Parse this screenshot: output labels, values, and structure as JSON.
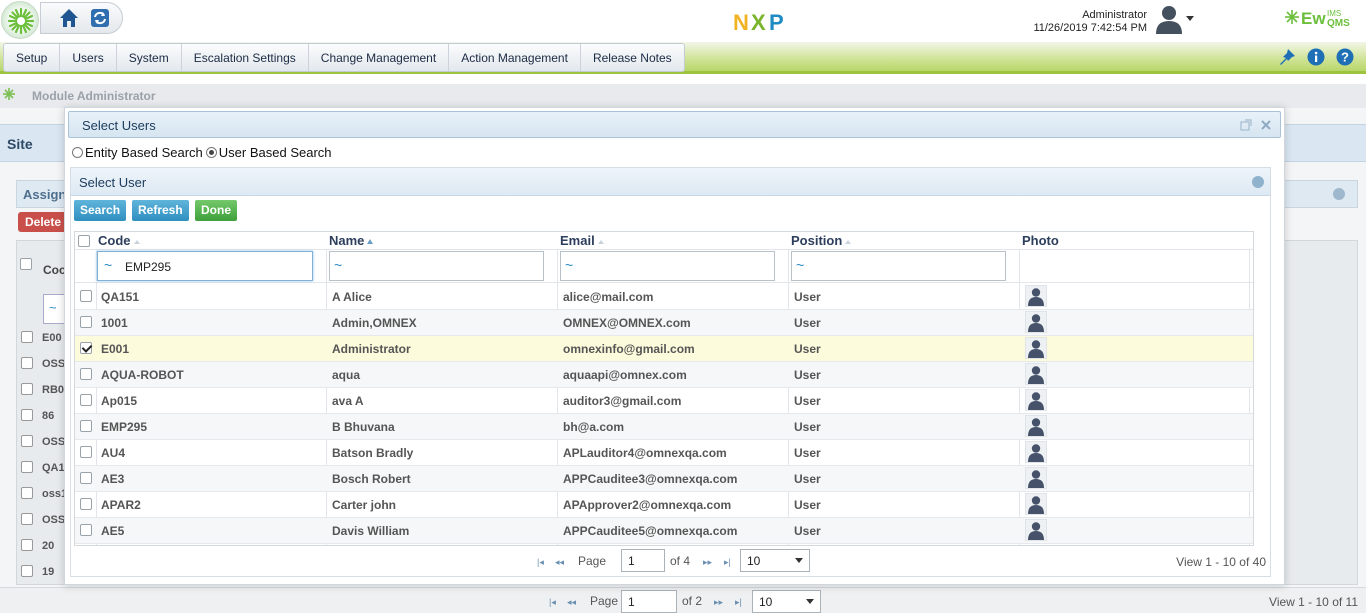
{
  "header": {
    "user_name": "Administrator",
    "datetime": "11/26/2019 7:42:54 PM",
    "brand_logo_text": "NXP",
    "product_logo_text": "EwQMS",
    "product_logo_super": "IMS",
    "icons": [
      "app-logo-icon",
      "home-icon",
      "refresh-icon",
      "user-avatar-icon",
      "pin-icon",
      "info-icon",
      "help-icon"
    ]
  },
  "menu": [
    "Setup",
    "Users",
    "System",
    "Escalation Settings",
    "Change Management",
    "Action Management",
    "Release Notes"
  ],
  "breadcrumb": "Module Administrator",
  "background": {
    "site_label": "Site",
    "assign_label": "Assigne",
    "delete_label": "Delete",
    "code_header": "Coc",
    "rows": [
      "E00",
      "OSS",
      "RB0",
      "86",
      "OSS",
      "QA1",
      "oss1",
      "OSS",
      "20",
      "19"
    ],
    "pager": {
      "page_label": "Page",
      "page": "1",
      "of_label": "of 2",
      "page_size": "10",
      "view": "View 1 - 10 of 11"
    }
  },
  "dialog": {
    "title": "Select Users",
    "radio_entity": "Entity Based Search",
    "radio_user": "User Based Search",
    "radio_selected": "user",
    "panel_title": "Select User",
    "buttons": {
      "search": "Search",
      "refresh": "Refresh",
      "done": "Done"
    },
    "columns": [
      "Code",
      "Name",
      "Email",
      "Position",
      "Photo"
    ],
    "filters": {
      "code": "EMP295",
      "name": "",
      "email": "",
      "position": ""
    },
    "filter_tilde": "~",
    "rows": [
      {
        "code": "QA151",
        "name": "A Alice",
        "email": "alice@mail.com",
        "position": "User",
        "checked": false
      },
      {
        "code": "1001",
        "name": "Admin,OMNEX",
        "email": "OMNEX@OMNEX.com",
        "position": "User",
        "checked": false
      },
      {
        "code": "E001",
        "name": "Administrator",
        "email": "omnexinfo@gmail.com",
        "position": "User",
        "checked": true
      },
      {
        "code": "AQUA-ROBOT",
        "name": "aqua",
        "email": "aquaapi@omnex.com",
        "position": "User",
        "checked": false
      },
      {
        "code": "Ap015",
        "name": "ava A",
        "email": "auditor3@gmail.com",
        "position": "User",
        "checked": false
      },
      {
        "code": "EMP295",
        "name": "B Bhuvana",
        "email": "bh@a.com",
        "position": "User",
        "checked": false
      },
      {
        "code": "AU4",
        "name": "Batson Bradly",
        "email": "APLauditor4@omnexqa.com",
        "position": "User",
        "checked": false
      },
      {
        "code": "AE3",
        "name": "Bosch Robert",
        "email": "APPCauditee3@omnexqa.com",
        "position": "User",
        "checked": false
      },
      {
        "code": "APAR2",
        "name": "Carter john",
        "email": "APApprover2@omnexqa.com",
        "position": "User",
        "checked": false
      },
      {
        "code": "AE5",
        "name": "Davis William",
        "email": "APPCauditee5@omnexqa.com",
        "position": "User",
        "checked": false
      }
    ],
    "pager": {
      "page_label": "Page",
      "page": "1",
      "of_label": "of 4",
      "page_size": "10",
      "view": "View 1 - 10 of 40"
    }
  }
}
